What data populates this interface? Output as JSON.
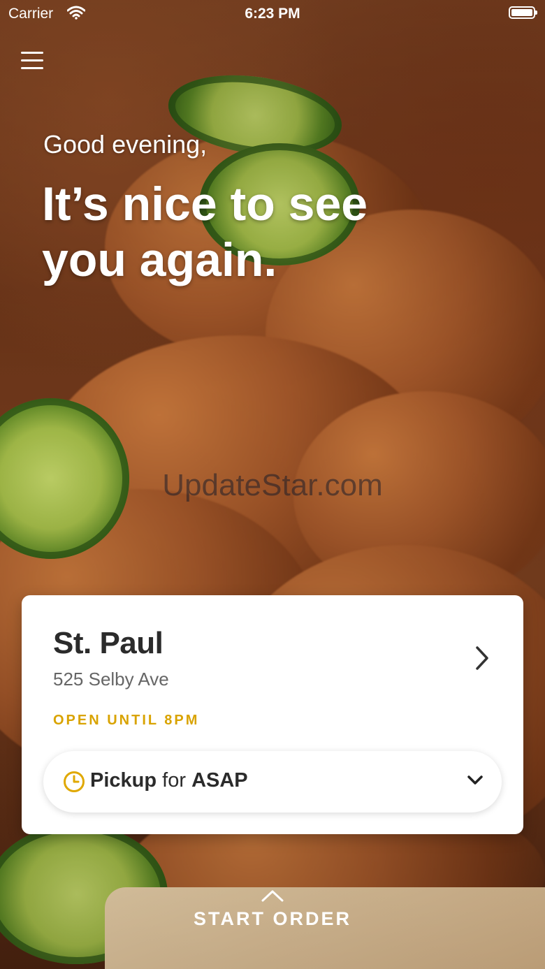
{
  "status_bar": {
    "carrier": "Carrier",
    "time": "6:23 PM",
    "battery_level": 1.0
  },
  "header": {
    "menu_icon": "hamburger-menu-icon"
  },
  "hero": {
    "greeting": "Good evening,",
    "headline": "It’s nice to see you again."
  },
  "watermark": "UpdateStar.com",
  "location": {
    "name": "St. Paul",
    "address": "525 Selby Ave",
    "hours": "OPEN UNTIL 8PM",
    "hours_color": "#d9a300",
    "pickup": {
      "mode": "Pickup",
      "connector": "for",
      "time": "ASAP",
      "clock_color": "#e0a800"
    }
  },
  "footer": {
    "start_order_label": "START ORDER"
  }
}
